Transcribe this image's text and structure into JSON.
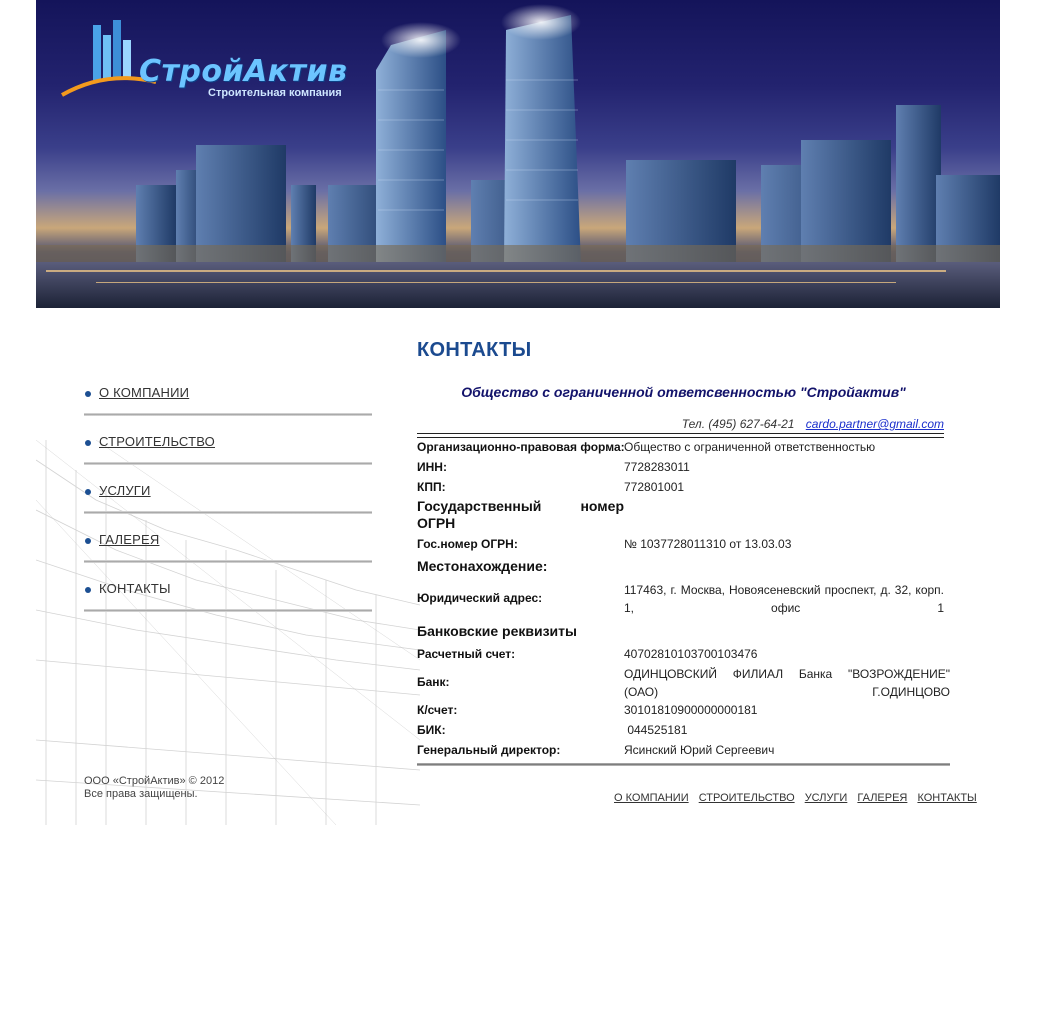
{
  "header": {
    "logo_name": "СтройАктив",
    "logo_tagline": "Строительная компания"
  },
  "nav": {
    "items": [
      {
        "label": "О КОМПАНИИ"
      },
      {
        "label": "СТРОИТЕЛЬСТВО"
      },
      {
        "label": "УСЛУГИ"
      },
      {
        "label": "ГАЛЕРЕЯ"
      },
      {
        "label": "КОНТАКТЫ"
      }
    ]
  },
  "main": {
    "title": "КОНТАКТЫ",
    "company_name": "Общество с ограниченной ответсвенностью \"Стройактив\"",
    "phone": "Тел. (495) 627-64-21",
    "email": "cardo.partner@gmail.com",
    "legal_form_label": "Организационно-правовая форма:",
    "legal_form_value": "Общество с ограниченной ответственностью",
    "inn_label": "ИНН:",
    "inn_value": "7728283011",
    "kpp_label": "КПП:",
    "kpp_value": "772801001",
    "ogrn_section_line1": "Государственный номер",
    "ogrn_section_line2": "ОГРН",
    "ogrn_label": "Гос.номер ОГРН:",
    "ogrn_value": "№ 1037728011310 от 13.03.03",
    "location_section": "Местонахождение:",
    "address_label": "Юридический адрес:",
    "address_value": "117463, г. Москва, Новоясеневский проспект, д. 32, корп. 1, офис 1",
    "bank_section": "Банковские реквизиты",
    "account_label": "Расчетный счет:",
    "account_value": "40702810103700103476",
    "bank_label": "Банк:",
    "bank_value": "ОДИНЦОВСКИЙ ФИЛИАЛ Банка \"ВОЗРОЖДЕНИЕ\" (ОАО) Г.ОДИНЦОВО",
    "corr_label": "К/счет:",
    "corr_value": "30101810900000000181",
    "bik_label": "БИК:",
    "bik_value": " 044525181",
    "director_label": "Генеральный директор:",
    "director_value": "Ясинский Юрий Сергеевич"
  },
  "footer": {
    "copyright_line1": "ООО «СтройАктив» © 2012",
    "copyright_line2": "Все права защищены.",
    "links": [
      "О КОМПАНИИ",
      "СТРОИТЕЛЬСТВО",
      "УСЛУГИ",
      "ГАЛЕРЕЯ",
      "КОНТАКТЫ"
    ]
  },
  "colors": {
    "title_blue": "#1b4a8f",
    "company_navy": "#13136b",
    "link_blue": "#1a2fcc",
    "bullet_blue": "#1c4f92"
  }
}
